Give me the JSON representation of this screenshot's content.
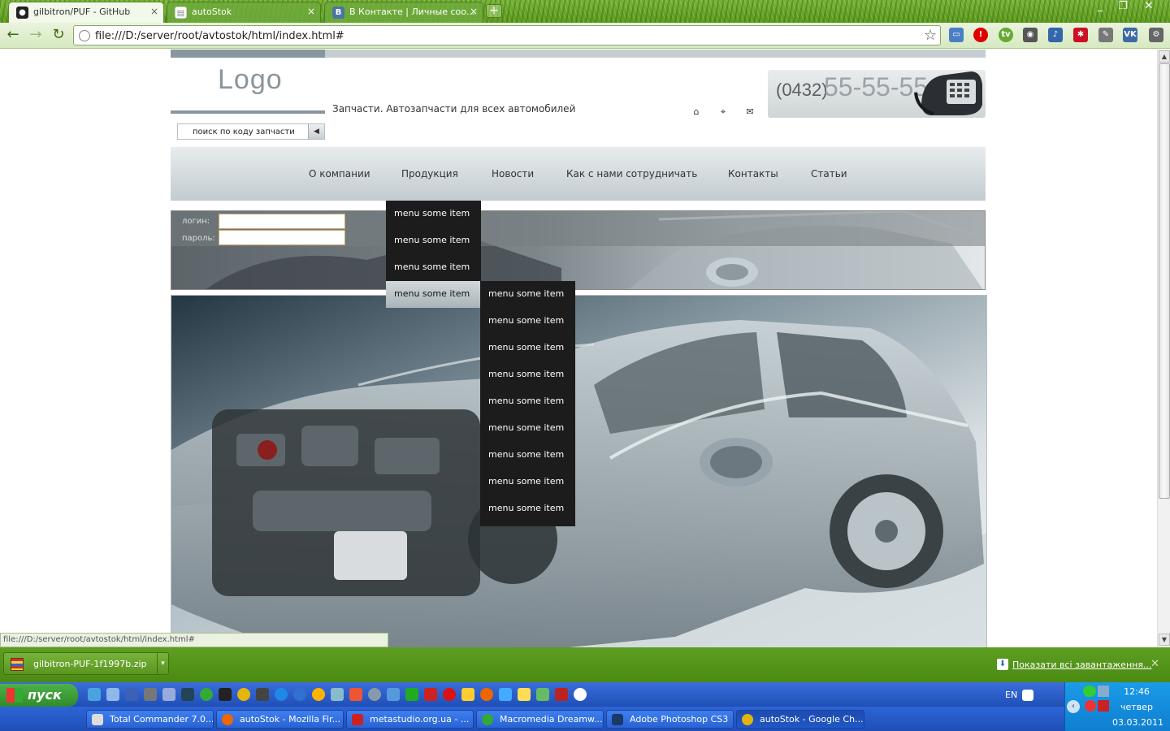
{
  "browser": {
    "tabs": [
      {
        "title": "gilbitron/PUF - GitHub",
        "icon": "github-icon"
      },
      {
        "title": "autoStok",
        "icon": "page-icon"
      },
      {
        "title": "В Контакте | Личные соо...",
        "icon": "vk-icon"
      }
    ],
    "url": "file:///D:/server/root/avtostok/html/index.html#",
    "extensions": [
      "screenshot-icon",
      "opera-icon",
      "tv-icon",
      "camera-icon",
      "mic-icon",
      "puzzle-icon",
      "pen-icon",
      "vk-icon"
    ]
  },
  "site": {
    "logo": "Logo",
    "tagline": "Запчасти. Автозапчасти для всех автомобилей",
    "quick_icons": [
      "home-icon",
      "sitemap-icon",
      "mail-icon"
    ],
    "phone_code": "(0432)",
    "phone_number": "55-55-55",
    "search_placeholder": "поиск по коду запчасти",
    "nav": [
      {
        "label": "О компании"
      },
      {
        "label": "Продукция"
      },
      {
        "label": "Новости"
      },
      {
        "label": "Как с нами сотрудничать"
      },
      {
        "label": "Контакты"
      },
      {
        "label": "Статьи"
      }
    ],
    "login": {
      "login_label": "логин:",
      "password_label": "пароль:",
      "login_value": "",
      "password_value": ""
    },
    "dropdown_level1": [
      "menu some item",
      "menu some item",
      "menu some item",
      "menu some item"
    ],
    "dropdown_level2": [
      "menu some item",
      "menu some item",
      "menu some item",
      "menu some item",
      "menu some item",
      "menu some item",
      "menu some item",
      "menu some item",
      "menu some item"
    ]
  },
  "status_bar": "file:///D:/server/root/avtostok/html/index.html#",
  "downloads": {
    "file": "gilbitron-PUF-1f1997b.zip",
    "show_all": "Показати всі завантаження..."
  },
  "taskbar": {
    "start": "пуск",
    "buttons": [
      {
        "label": "Total Commander 7.0..."
      },
      {
        "label": "autoStok - Mozilla Fir..."
      },
      {
        "label": "metastudio.org.ua - ..."
      },
      {
        "label": "Macromedia Dreamw..."
      },
      {
        "label": "Adobe Photoshop CS3"
      },
      {
        "label": "autoStok - Google Ch..."
      }
    ],
    "lang": "EN",
    "time": "12:46",
    "day": "четвер",
    "date": "03.03.2011"
  },
  "colors": {
    "chrome_green": "#5b9a1e",
    "nav_gray": "#c2cbcf",
    "dropdown_bg": "#1c1c1c"
  }
}
